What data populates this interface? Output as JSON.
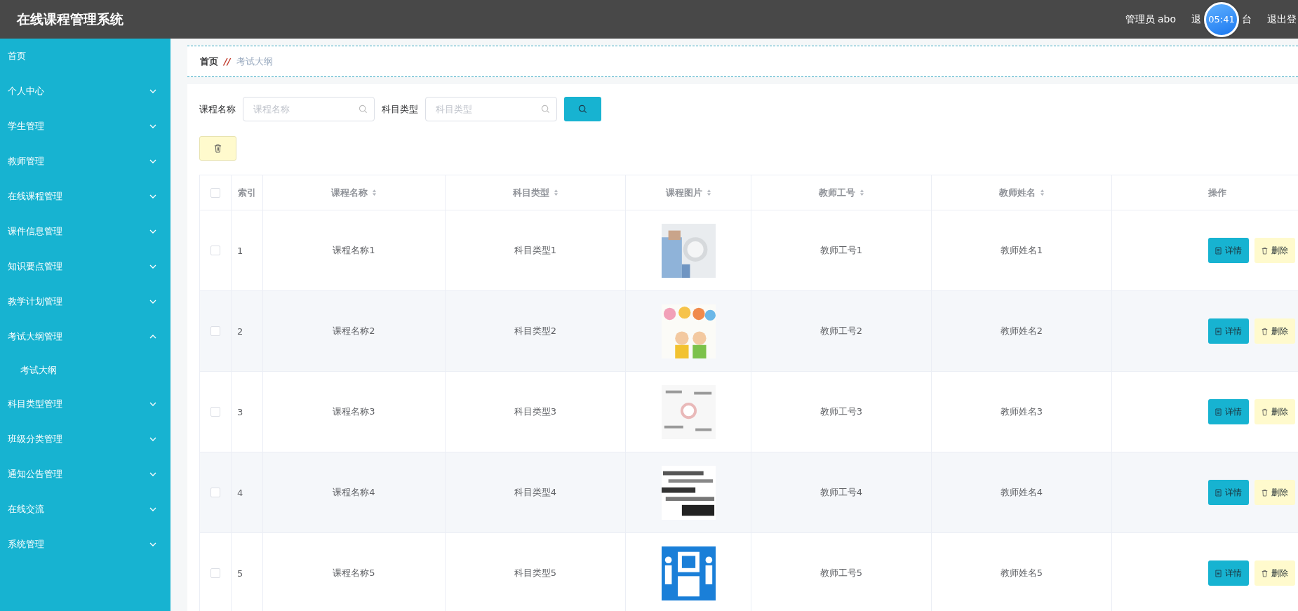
{
  "header": {
    "title": "在线课程管理系统",
    "user": "管理员 abo",
    "front_link": {
      "before": "退",
      "after": "台"
    },
    "clock": "05:41",
    "logout": "退出登"
  },
  "sidebar": {
    "items": [
      {
        "label": "首页",
        "kind": "link"
      },
      {
        "label": "个人中心",
        "kind": "menu",
        "expanded": false
      },
      {
        "label": "学生管理",
        "kind": "menu",
        "expanded": false
      },
      {
        "label": "教师管理",
        "kind": "menu",
        "expanded": false
      },
      {
        "label": "在线课程管理",
        "kind": "menu",
        "expanded": false
      },
      {
        "label": "课件信息管理",
        "kind": "menu",
        "expanded": false
      },
      {
        "label": "知识要点管理",
        "kind": "menu",
        "expanded": false
      },
      {
        "label": "教学计划管理",
        "kind": "menu",
        "expanded": false
      },
      {
        "label": "考试大纲管理",
        "kind": "menu",
        "expanded": true,
        "children": [
          {
            "label": "考试大纲"
          }
        ]
      },
      {
        "label": "科目类型管理",
        "kind": "menu",
        "expanded": false
      },
      {
        "label": "班级分类管理",
        "kind": "menu",
        "expanded": false
      },
      {
        "label": "通知公告管理",
        "kind": "menu",
        "expanded": false
      },
      {
        "label": "在线交流",
        "kind": "menu",
        "expanded": false
      },
      {
        "label": "系统管理",
        "kind": "menu",
        "expanded": false
      }
    ]
  },
  "breadcrumb": {
    "separator": "//",
    "items": [
      {
        "label": "首页",
        "current": false
      },
      {
        "label": "考试大纲",
        "current": true
      }
    ]
  },
  "search": {
    "fields": [
      {
        "label": "课程名称",
        "placeholder": "课程名称"
      },
      {
        "label": "科目类型",
        "placeholder": "科目类型"
      }
    ]
  },
  "table": {
    "header_checked": false,
    "columns": [
      {
        "label": "索引",
        "sortable": false
      },
      {
        "label": "课程名称",
        "sortable": true
      },
      {
        "label": "科目类型",
        "sortable": true
      },
      {
        "label": "课程图片",
        "sortable": true
      },
      {
        "label": "教师工号",
        "sortable": true
      },
      {
        "label": "教师姓名",
        "sortable": true
      },
      {
        "label": "操作",
        "sortable": false
      }
    ],
    "rows": [
      {
        "checked": false,
        "index": "1",
        "name": "课程名称1",
        "type": "科目类型1",
        "teacher_no": "教师工号1",
        "teacher_name": "教师姓名1",
        "actions": [
          {
            "kind": "detail",
            "label": "详情"
          },
          {
            "kind": "delete",
            "label": "删除"
          }
        ]
      },
      {
        "checked": false,
        "index": "2",
        "name": "课程名称2",
        "type": "科目类型2",
        "teacher_no": "教师工号2",
        "teacher_name": "教师姓名2",
        "actions": [
          {
            "kind": "detail",
            "label": "详情"
          },
          {
            "kind": "delete",
            "label": "删除"
          }
        ]
      },
      {
        "checked": false,
        "index": "3",
        "name": "课程名称3",
        "type": "科目类型3",
        "teacher_no": "教师工号3",
        "teacher_name": "教师姓名3",
        "actions": [
          {
            "kind": "detail",
            "label": "详情"
          },
          {
            "kind": "delete",
            "label": "删除"
          }
        ]
      },
      {
        "checked": false,
        "index": "4",
        "name": "课程名称4",
        "type": "科目类型4",
        "teacher_no": "教师工号4",
        "teacher_name": "教师姓名4",
        "actions": [
          {
            "kind": "detail",
            "label": "详情"
          },
          {
            "kind": "delete",
            "label": "删除"
          }
        ]
      },
      {
        "checked": false,
        "index": "5",
        "name": "课程名称5",
        "type": "科目类型5",
        "teacher_no": "教师工号5",
        "teacher_name": "教师姓名5",
        "actions": [
          {
            "kind": "detail",
            "label": "详情"
          },
          {
            "kind": "delete",
            "label": "删除"
          }
        ]
      }
    ]
  }
}
